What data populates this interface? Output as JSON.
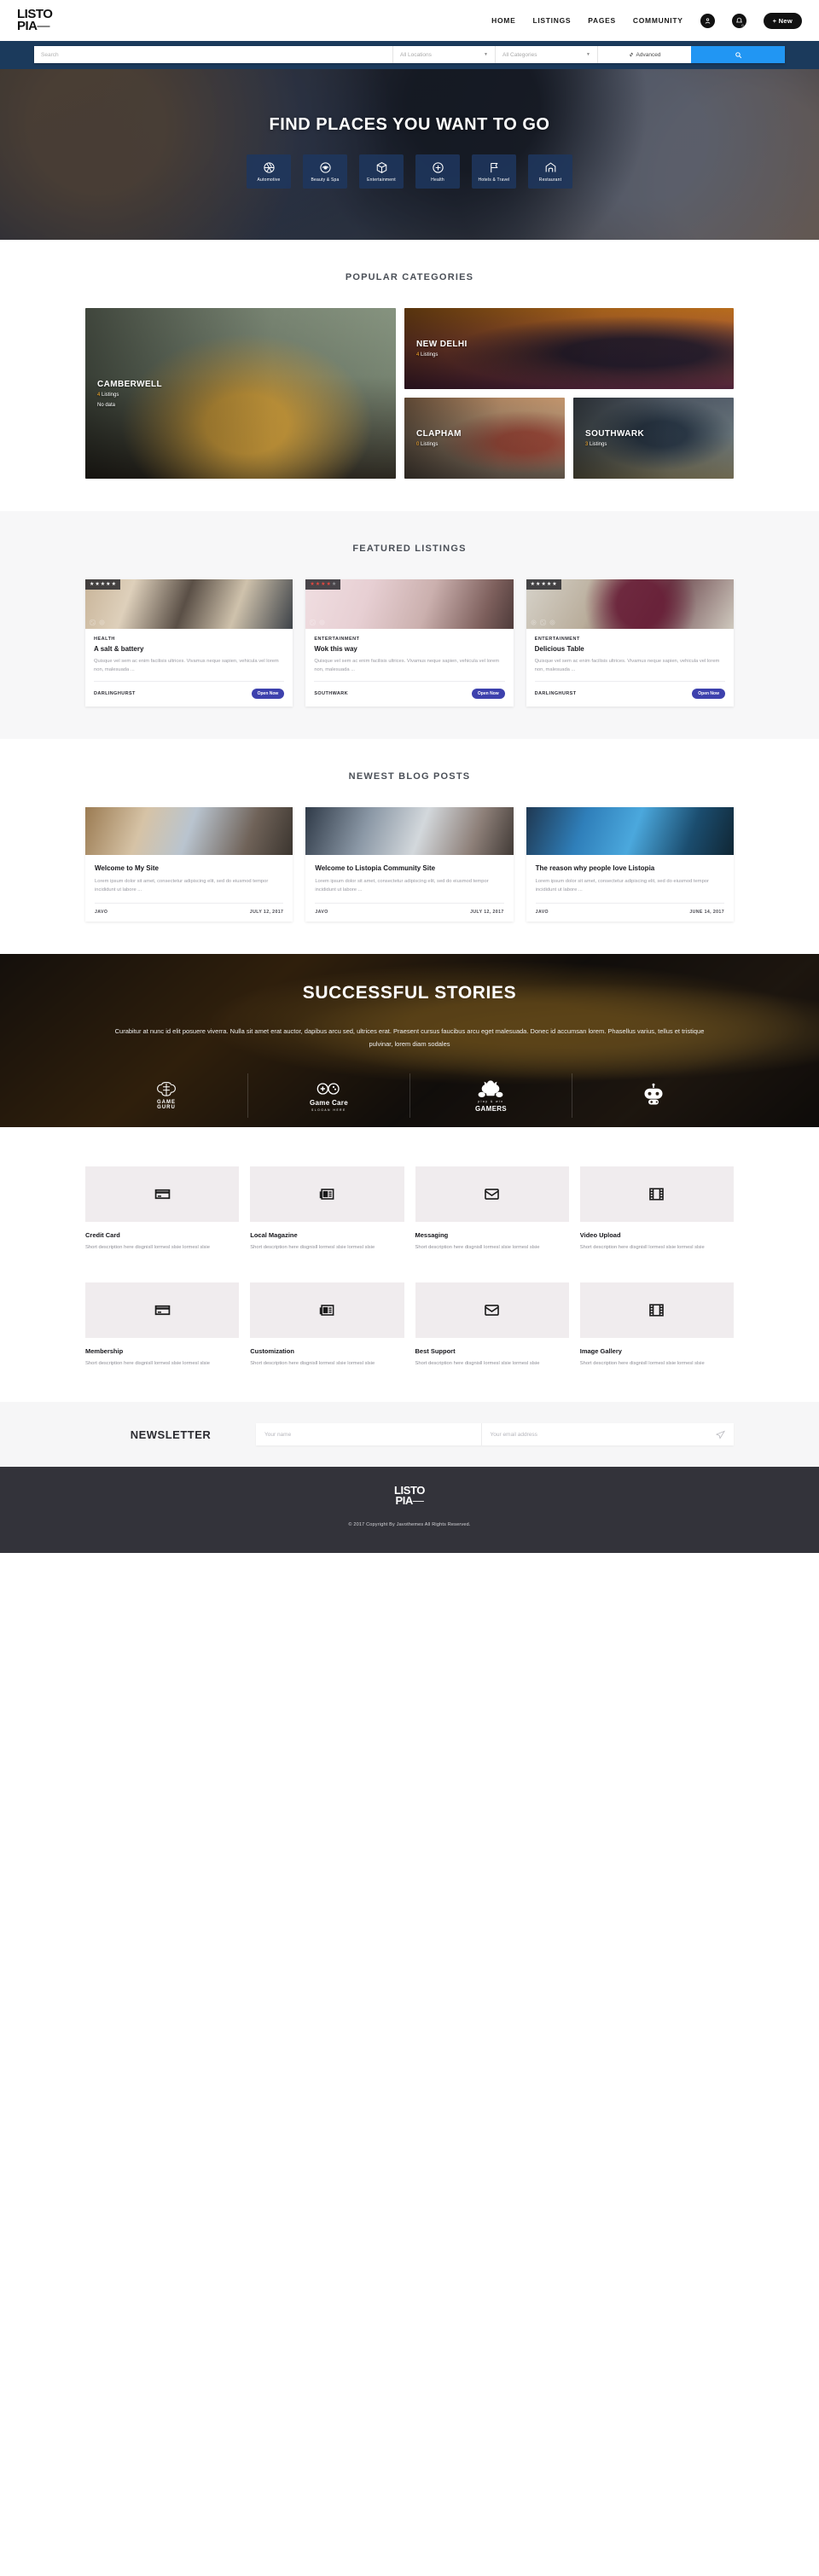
{
  "header": {
    "logo_line1": "LISTO",
    "logo_line2": "PIA",
    "logo_dash": "—",
    "nav": [
      {
        "label": "HOME"
      },
      {
        "label": "LISTINGS"
      },
      {
        "label": "PAGES"
      },
      {
        "label": "COMMUNITY"
      }
    ],
    "account_icon": "user-icon",
    "notification_icon": "bell-icon",
    "notification_count": "0",
    "new_button": "+ New"
  },
  "searchbar": {
    "search_placeholder": "Search",
    "location_value": "All Locations",
    "category_value": "All Categories",
    "advanced_label": "Advanced",
    "advanced_icon": "gear-icon",
    "search_icon": "search-icon",
    "accent": "#2196f3"
  },
  "hero": {
    "title": "FIND PLACES YOU WANT TO GO",
    "categories": [
      {
        "label": "Automotive",
        "icon": "aperture-icon"
      },
      {
        "label": "Beauty & Spa",
        "icon": "eye-icon"
      },
      {
        "label": "Entertainment",
        "icon": "cube-icon"
      },
      {
        "label": "Health",
        "icon": "plus-circle-icon"
      },
      {
        "label": "Hotels & Travel",
        "icon": "flag-icon"
      },
      {
        "label": "Restaurant",
        "icon": "home-icon"
      }
    ]
  },
  "popular_categories": {
    "title": "POPULAR CATEGORIES",
    "places": [
      {
        "name": "CAMBERWELL",
        "count": "4",
        "listings_label": "Listings",
        "extra": "No data",
        "photo": "p-paris"
      },
      {
        "name": "NEW DELHI",
        "count": "4",
        "listings_label": "Listings",
        "extra": "",
        "photo": "p-delhi"
      },
      {
        "name": "CLAPHAM",
        "count": "0",
        "listings_label": "Listings",
        "extra": "",
        "photo": "p-clapham"
      },
      {
        "name": "SOUTHWARK",
        "count": "3",
        "listings_label": "Listings",
        "extra": "",
        "photo": "p-southwark"
      }
    ]
  },
  "featured_listings": {
    "title": "FEATURED LISTINGS",
    "open_now_label": "Open Now",
    "cards": [
      {
        "rating": 5,
        "star_color": "white",
        "category": "HEALTH",
        "name": "A salt & battery",
        "description": "Quisque vel sem ac enim facilisis ultrices. Vivamus neque sapien, vehicula vel lorem non, malesuada ...",
        "location": "DARLINGHURST",
        "photo": "p-shop",
        "icons": [
          "expand-icon",
          "eye-icon"
        ]
      },
      {
        "rating": 4,
        "star_color": "red",
        "category": "ENTERTAINMENT",
        "name": "Wok this way",
        "description": "Quisque vel sem ac enim facilisis ultrices. Vivamus neque sapien, vehicula vel lorem non, malesuada ...",
        "location": "SOUTHWARK",
        "photo": "p-brush",
        "icons": [
          "expand-icon",
          "eye-icon"
        ]
      },
      {
        "rating": 5,
        "star_color": "white",
        "category": "ENTERTAINMENT",
        "name": "Delicious Table",
        "description": "Quisque vel sem ac enim facilisis ultrices. Vivamus neque sapien, vehicula vel lorem non, malesuada ...",
        "location": "DARLINGHURST",
        "photo": "p-food",
        "icons": [
          "play-icon",
          "expand-icon",
          "eye-icon"
        ]
      }
    ]
  },
  "blog": {
    "title": "NEWEST BLOG POSTS",
    "posts": [
      {
        "title": "Welcome to My Site",
        "excerpt": "Lorem ipsum dolor sit amet, consectetur adipiscing elit, sed do eiusmod tempor incididunt ut labore ...",
        "author": "JAVO",
        "date": "JULY 12, 2017",
        "photo": "p-store"
      },
      {
        "title": "Welcome to Listopia Community Site",
        "excerpt": "Lorem ipsum dolor sit amet, consectetur adipiscing elit, sed do eiusmod tempor incididunt ut labore ...",
        "author": "JAVO",
        "date": "JULY 12, 2017",
        "photo": "p-crowd"
      },
      {
        "title": "The reason why people love Listopia",
        "excerpt": "Lorem ipsum dolor sit amet, consectetur adipiscing elit, sed do eiusmod tempor incididunt ut labore ...",
        "author": "JAVO",
        "date": "JUNE 14, 2017",
        "photo": "p-concert"
      }
    ]
  },
  "stories": {
    "title": "SUCCESSFUL STORIES",
    "text": "Curabitur at nunc id elit posuere viverra. Nulla sit amet erat auctor, dapibus arcu sed, ultrices erat. Praesent cursus faucibus arcu eget malesuada. Donec id accumsan lorem. Phasellus varius, tellus et tristique pulvinar, lorem diam sodales",
    "brands": [
      {
        "name": "GAME GURU",
        "line1": "GAME",
        "line2": "GURU",
        "slogan": "",
        "icon": "brain-icon"
      },
      {
        "name": "Game Care",
        "line1": "Game Care",
        "line2": "",
        "slogan": "SLOGAN HERE",
        "icon": "infinity-gamepad-icon"
      },
      {
        "name": "GAMERS",
        "line1": "play & win",
        "line2": "GAMERS",
        "slogan": "",
        "icon": "gamer-face-icon"
      },
      {
        "name": "Robot Gamer",
        "line1": "",
        "line2": "",
        "slogan": "",
        "icon": "robot-gamepad-icon"
      }
    ]
  },
  "features": {
    "rows": [
      [
        {
          "title": "Credit Card",
          "desc": "Short description here disgnisll lormesl slsie lormesl slsie",
          "icon": "credit-card-icon"
        },
        {
          "title": "Local Magazine",
          "desc": "Short description here disgnisll lormesl slsie lormesl slsie",
          "icon": "newspaper-icon"
        },
        {
          "title": "Messaging",
          "desc": "Short description here disgnisll lormesl slsie lormesl slsie",
          "icon": "envelope-icon"
        },
        {
          "title": "Video Upload",
          "desc": "Short description here disgnisll lormesl slsie lormesl slsie",
          "icon": "film-icon"
        }
      ],
      [
        {
          "title": "Membership",
          "desc": "Short description here disgnisll lormesl slsie lormesl slsie",
          "icon": "membership-card-icon"
        },
        {
          "title": "Customization",
          "desc": "Short description here disgnisll lormesl slsie lormesl slsie",
          "icon": "newspaper-icon"
        },
        {
          "title": "Best Support",
          "desc": "Short description here disgnisll lormesl slsie lormesl slsie",
          "icon": "envelope-icon"
        },
        {
          "title": "Image Gallery",
          "desc": "Short description here disgnisll lormesl slsie lormesl slsie",
          "icon": "film-icon"
        }
      ]
    ]
  },
  "newsletter": {
    "title": "NEWSLETTER",
    "name_placeholder": "Your name",
    "email_placeholder": "Your email address",
    "send_icon": "send-icon"
  },
  "footer": {
    "logo_line1": "LISTO",
    "logo_line2": "PIA",
    "logo_dash": "—",
    "copyright": "© 2017 Copyright By Javothemes All Rights Reserved."
  }
}
